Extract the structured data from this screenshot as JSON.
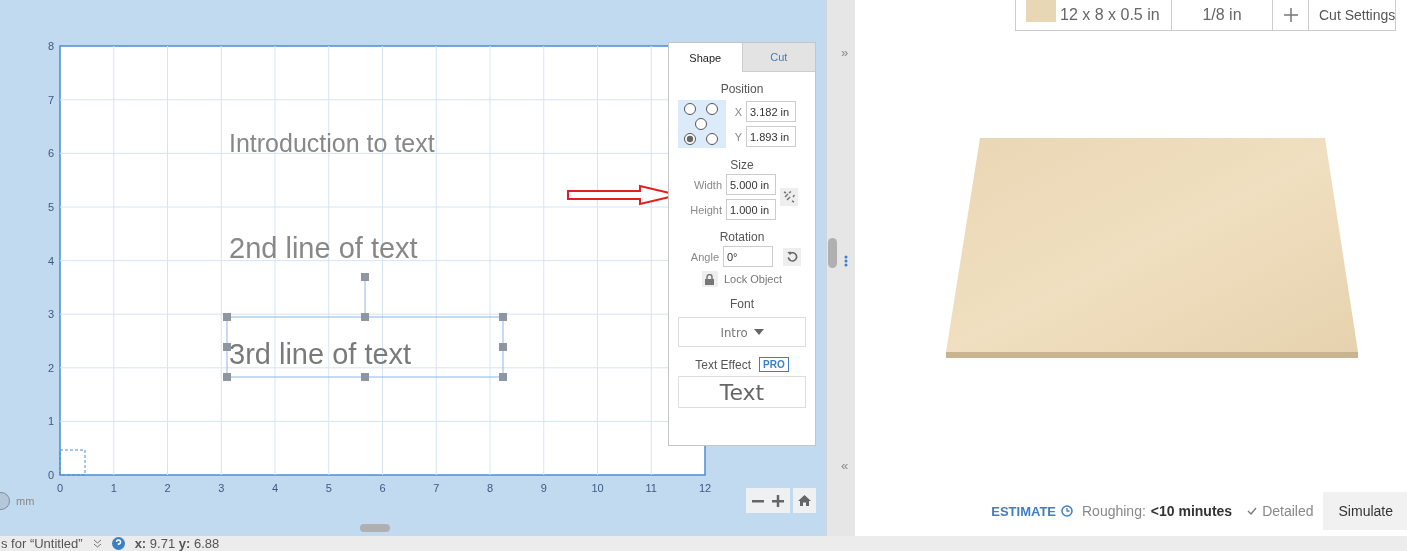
{
  "canvas": {
    "y_ticks": [
      "8",
      "7",
      "6",
      "5",
      "4",
      "3",
      "2",
      "1",
      "0"
    ],
    "x_ticks": [
      "0",
      "1",
      "2",
      "3",
      "4",
      "5",
      "6",
      "7",
      "8",
      "9",
      "10",
      "11",
      "12"
    ],
    "texts": [
      {
        "text": "Introduction to text",
        "selected": false
      },
      {
        "text": "2nd line of text",
        "selected": false
      },
      {
        "text": "3rd line of text",
        "selected": true
      }
    ],
    "unit_label": "mm"
  },
  "shape_panel": {
    "tabs": [
      {
        "label": "Shape",
        "selected": true
      },
      {
        "label": "Cut",
        "selected": false
      }
    ],
    "position": {
      "title": "Position",
      "anchors": [
        {
          "selected": false
        },
        {
          "selected": false
        },
        {
          "selected": false
        },
        {
          "selected": true
        },
        {
          "selected": false
        }
      ],
      "x_label": "X",
      "x_value": "3.182 in",
      "y_label": "Y",
      "y_value": "1.893 in"
    },
    "size": {
      "title": "Size",
      "width_label": "Width",
      "width_value": "5.000 in",
      "height_label": "Height",
      "height_value": "1.000 in"
    },
    "rotation": {
      "title": "Rotation",
      "angle_label": "Angle",
      "angle_value": "0°"
    },
    "lock_label": "Lock Object",
    "font": {
      "title": "Font",
      "value": "Intro"
    },
    "text_effect": {
      "title": "Text Effect",
      "badge": "PRO",
      "preview": "Text"
    }
  },
  "material_bar": {
    "dimensions": "12 x 8 x 0.5 in",
    "bit": "1/8 in",
    "cut_settings": "Cut Settings"
  },
  "estimate": {
    "title": "ESTIMATE",
    "roughing_label": "Roughing:",
    "roughing_value": "<10 minutes",
    "detailed": "Detailed",
    "simulate": "Simulate"
  },
  "splitter": {
    "expand": "»",
    "collapse": "«"
  },
  "status_bar": {
    "project": "s for “Untitled”",
    "coordinates": "**x:** 9.71 **y:** 6.88"
  }
}
